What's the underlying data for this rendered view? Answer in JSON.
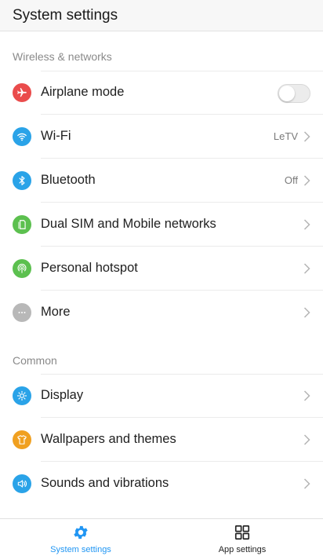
{
  "header": {
    "title": "System settings"
  },
  "sections": {
    "wireless": {
      "label": "Wireless & networks"
    },
    "common": {
      "label": "Common"
    }
  },
  "rows": {
    "airplane": {
      "label": "Airplane mode",
      "icon": "airplane-icon",
      "color": "#ea4c4c",
      "toggle_on": false
    },
    "wifi": {
      "label": "Wi-Fi",
      "value": "LeTV",
      "icon": "wifi-icon",
      "color": "#2aa3e8"
    },
    "bluetooth": {
      "label": "Bluetooth",
      "value": "Off",
      "icon": "bluetooth-icon",
      "color": "#2aa3e8"
    },
    "dualsim": {
      "label": "Dual SIM and Mobile networks",
      "icon": "sim-card-icon",
      "color": "#5cc04f"
    },
    "hotspot": {
      "label": "Personal hotspot",
      "icon": "hotspot-icon",
      "color": "#5cc04f"
    },
    "more": {
      "label": "More",
      "icon": "more-dots-icon",
      "color": "#b8b8b8"
    },
    "display": {
      "label": "Display",
      "icon": "display-icon",
      "color": "#2aa3e8"
    },
    "wallpapers": {
      "label": "Wallpapers and themes",
      "icon": "tshirt-icon",
      "color": "#f0a020"
    },
    "sounds": {
      "label": "Sounds and vibrations",
      "icon": "speaker-icon",
      "color": "#2aa3e8"
    }
  },
  "bottom_nav": {
    "system": {
      "label": "System settings",
      "icon": "gear-icon",
      "active": true,
      "color": "#2196f3"
    },
    "apps": {
      "label": "App settings",
      "icon": "grid-icon",
      "active": false,
      "color": "#222222"
    }
  }
}
